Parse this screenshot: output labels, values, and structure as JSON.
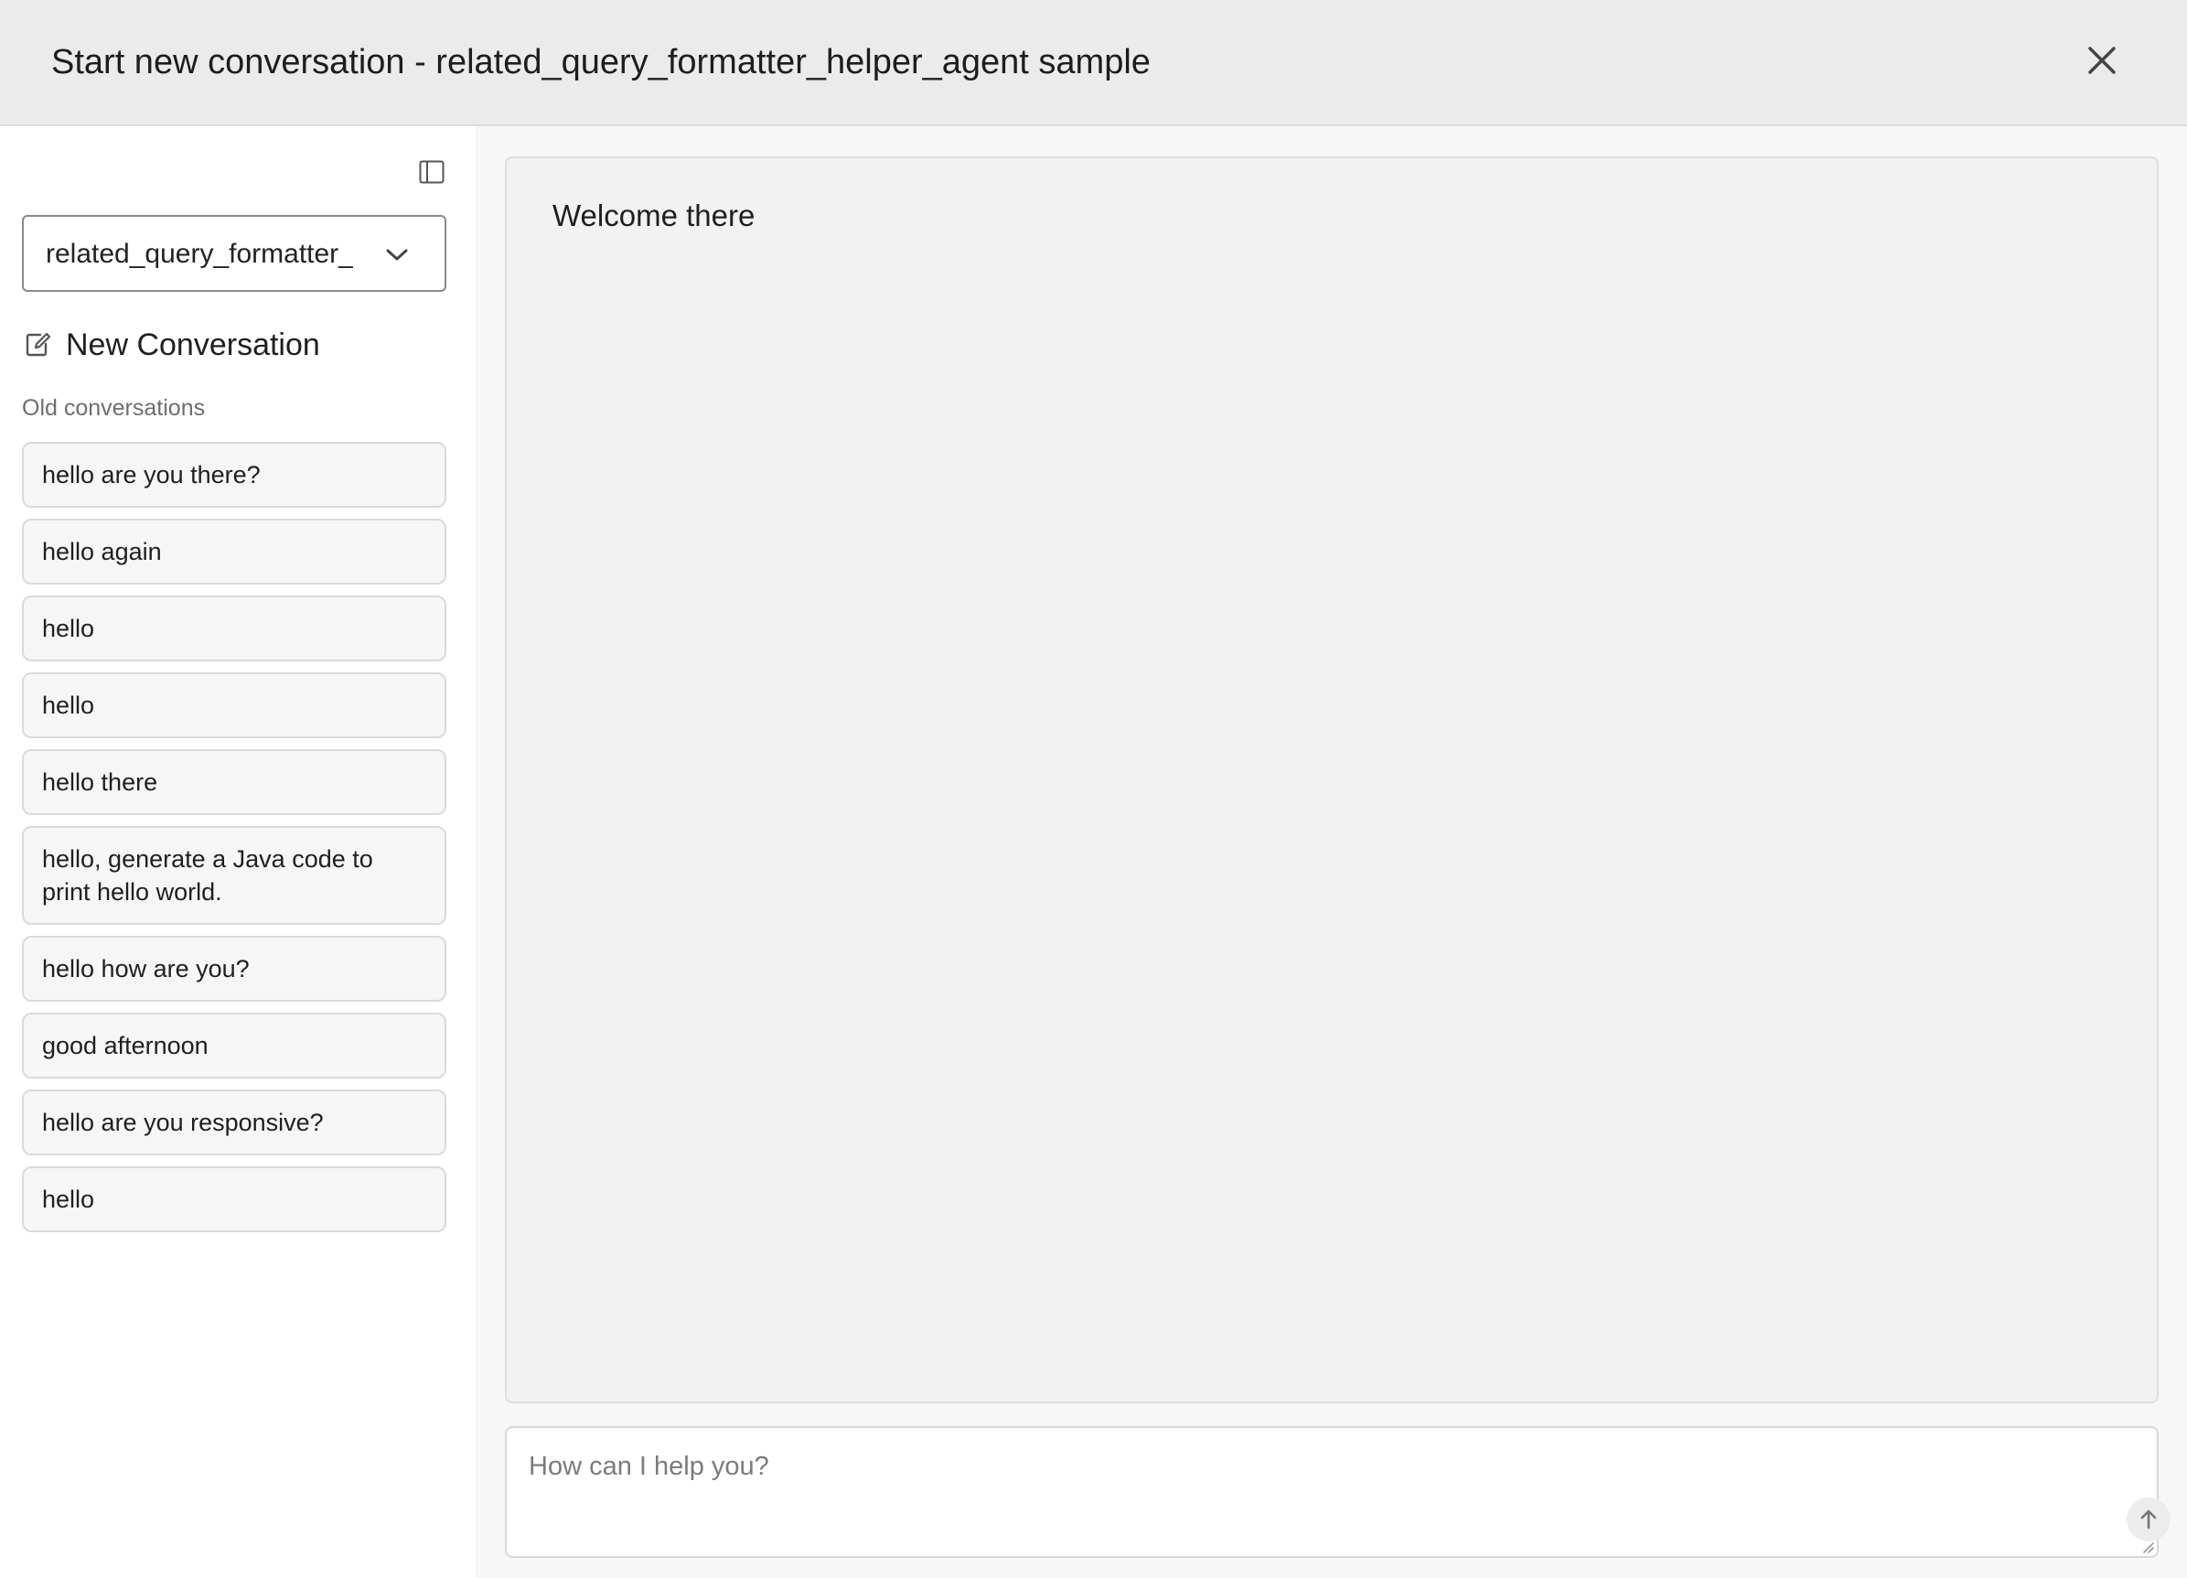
{
  "header": {
    "title": "Start new conversation - related_query_formatter_helper_agent sample",
    "close_icon": "close-icon"
  },
  "sidebar": {
    "collapse_icon": "sidebar-toggle-icon",
    "agent_select": {
      "value": "related_query_formatter_helper_agent",
      "chevron_icon": "chevron-down-icon"
    },
    "new_conversation": {
      "label": "New Conversation",
      "icon": "new-conversation-icon"
    },
    "old_conversations_label": "Old conversations",
    "conversations": [
      {
        "label": "hello are you there?"
      },
      {
        "label": "hello again"
      },
      {
        "label": "hello"
      },
      {
        "label": "hello"
      },
      {
        "label": "hello there"
      },
      {
        "label": "hello, generate a Java code to print hello world."
      },
      {
        "label": "hello how are you?"
      },
      {
        "label": "good afternoon"
      },
      {
        "label": "hello are you responsive?"
      },
      {
        "label": "hello"
      }
    ]
  },
  "chat": {
    "welcome_message": "Welcome there",
    "input": {
      "placeholder": "How can I help you?",
      "value": ""
    },
    "send_icon": "arrow-up-icon"
  },
  "colors": {
    "header_bg": "#ebebeb",
    "main_bg": "#f7f7f7",
    "panel_bg": "#f2f2f2",
    "item_bg": "#f6f6f6"
  }
}
